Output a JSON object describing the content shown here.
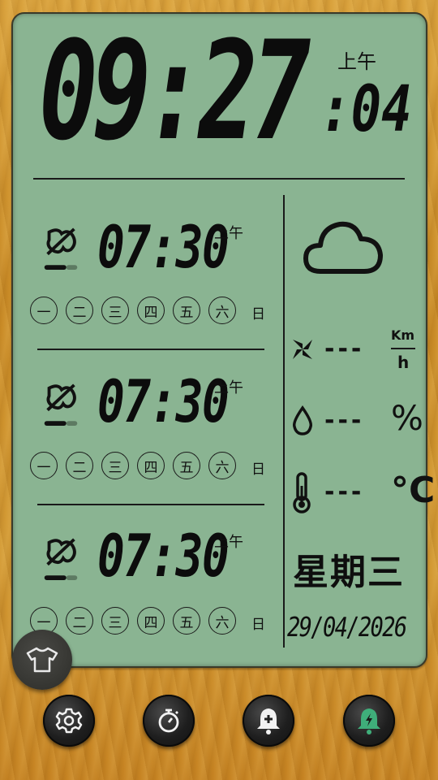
{
  "clock": {
    "hours_minutes": "09:27",
    "seconds": ":04",
    "ampm": "上午"
  },
  "alarms": [
    {
      "time": "07:30",
      "ampm": "上午",
      "enabled": false,
      "days": [
        "一",
        "二",
        "三",
        "四",
        "五",
        "六"
      ],
      "sunday": "日"
    },
    {
      "time": "07:30",
      "ampm": "上午",
      "enabled": false,
      "days": [
        "一",
        "二",
        "三",
        "四",
        "五",
        "六"
      ],
      "sunday": "日"
    },
    {
      "time": "07:30",
      "ampm": "上午",
      "enabled": false,
      "days": [
        "一",
        "二",
        "三",
        "四",
        "五",
        "六"
      ],
      "sunday": "日"
    }
  ],
  "weather": {
    "icon": "cloud-icon",
    "wind": {
      "value": "---",
      "unit_top": "Km",
      "unit_bottom": "h",
      "icon": "wind-icon"
    },
    "humidity": {
      "value": "---",
      "unit": "%",
      "icon": "droplet-icon"
    },
    "temperature": {
      "value": "---",
      "unit": "°C",
      "icon": "thermometer-icon"
    }
  },
  "weekday": "星期三",
  "date": "29/04/2026",
  "toolbar": {
    "buttons": [
      "gear-icon",
      "stopwatch-icon",
      "add-alarm-icon",
      "alarm-active-icon"
    ]
  },
  "theme_button": {
    "icon": "tshirt-icon"
  },
  "colors": {
    "lcd_background": "#8ab492",
    "wood": "#d39a34",
    "accent_green": "#3fae7a",
    "segment": "#0c0c0c"
  }
}
